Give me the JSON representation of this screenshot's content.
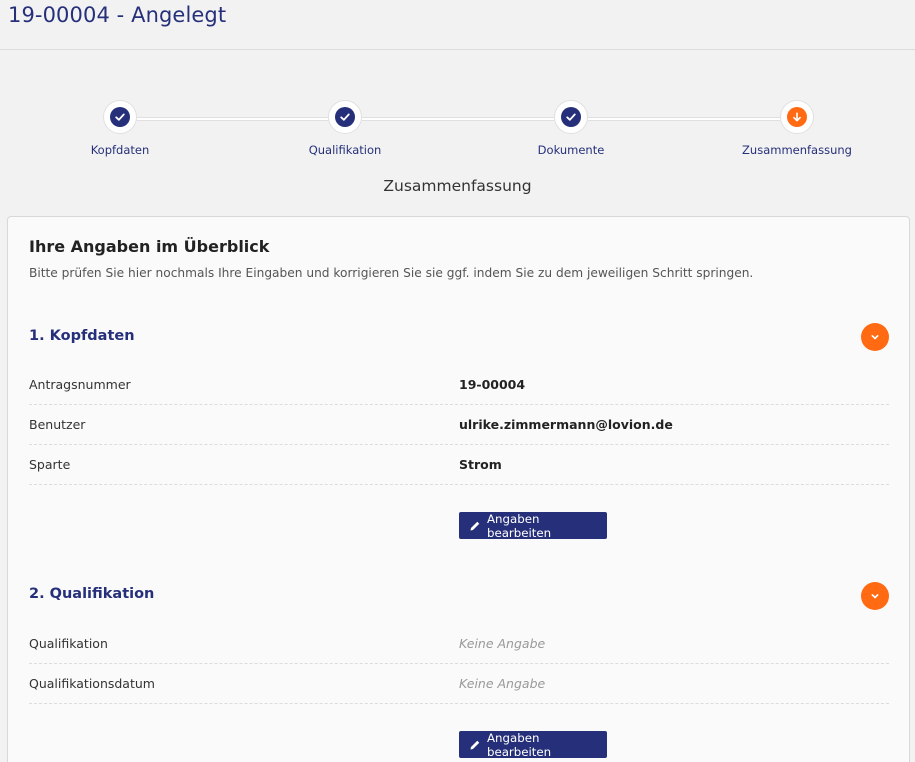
{
  "header": {
    "title": "19-00004 - Angelegt"
  },
  "stepper": {
    "steps": [
      {
        "label": "Kopfdaten",
        "state": "done",
        "icon": "check-icon"
      },
      {
        "label": "Qualifikation",
        "state": "done",
        "icon": "check-icon"
      },
      {
        "label": "Dokumente",
        "state": "done",
        "icon": "check-icon"
      },
      {
        "label": "Zusammenfassung",
        "state": "current",
        "icon": "arrow-down-icon"
      }
    ],
    "current_label": "Zusammenfassung"
  },
  "summary": {
    "title": "Ihre Angaben im Überblick",
    "subtitle": "Bitte prüfen Sie hier nochmals Ihre Eingaben und korrigieren Sie sie ggf. indem Sie zu dem jeweiligen Schritt springen.",
    "sections": [
      {
        "title": "1. Kopfdaten",
        "rows": [
          {
            "label": "Antragsnummer",
            "value": "19-00004"
          },
          {
            "label": "Benutzer",
            "value": "ulrike.zimmermann@lovion.de"
          },
          {
            "label": "Sparte",
            "value": "Strom"
          }
        ],
        "button_label": "Angaben bearbeiten"
      },
      {
        "title": "2. Qualifikation",
        "rows": [
          {
            "label": "Qualifikation",
            "value": "Keine Angabe"
          },
          {
            "label": "Qualifikationsdatum",
            "value": "Keine Angabe"
          }
        ],
        "button_label": "Angaben bearbeiten"
      }
    ]
  },
  "colors": {
    "primary": "#26307a",
    "accent": "#ff6a13",
    "background": "#f2f2f2"
  }
}
